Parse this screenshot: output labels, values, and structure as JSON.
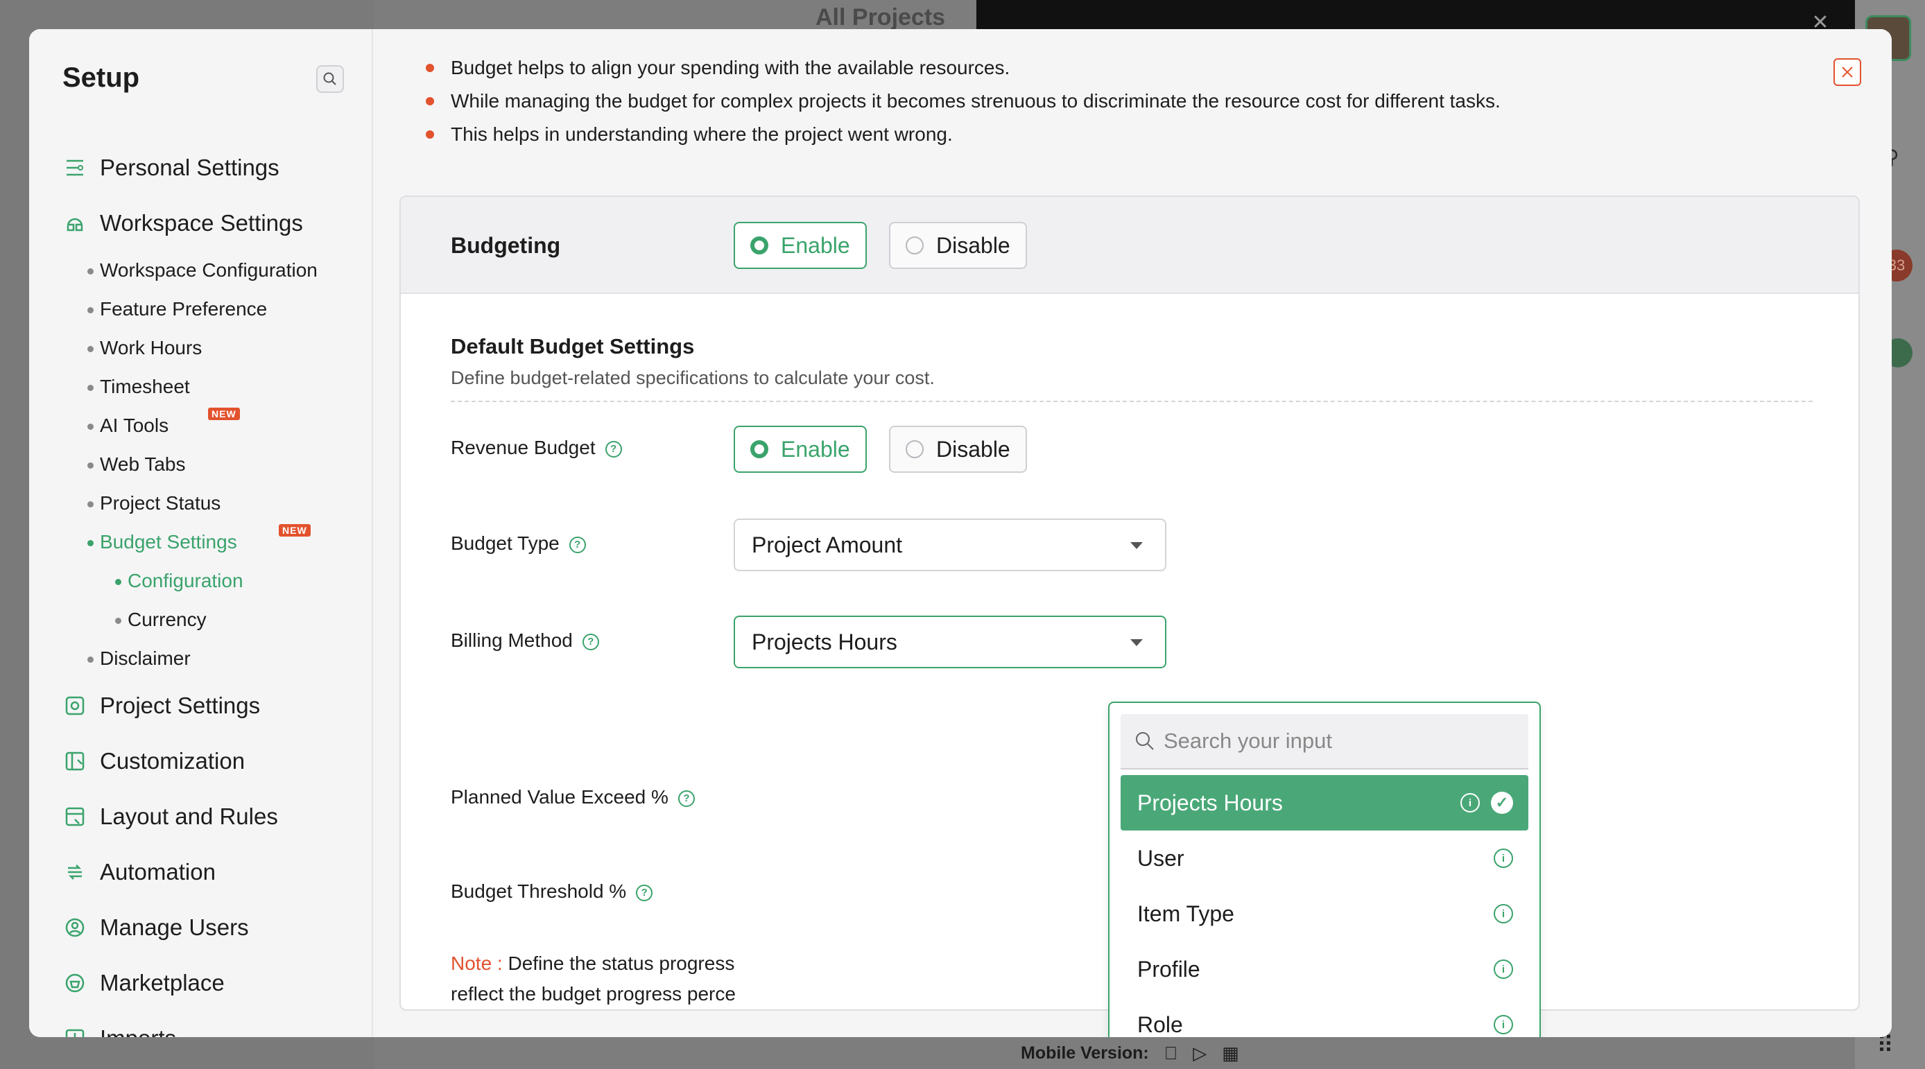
{
  "background": {
    "title": "All Projects",
    "mobile_version_label": "Mobile Version:",
    "notification_count": "33",
    "icons": [
      "apple-icon",
      "play-store-icon",
      "qr-code-icon",
      "grid-icon"
    ]
  },
  "sidebar": {
    "title": "Setup",
    "main_items": [
      {
        "label": "Personal Settings",
        "icon": "personal-settings-icon"
      },
      {
        "label": "Workspace Settings",
        "icon": "workspace-settings-icon"
      },
      {
        "label": "Project Settings",
        "icon": "project-settings-icon"
      },
      {
        "label": "Customization",
        "icon": "customization-icon"
      },
      {
        "label": "Layout and Rules",
        "icon": "layout-rules-icon"
      },
      {
        "label": "Automation",
        "icon": "automation-icon"
      },
      {
        "label": "Manage Users",
        "icon": "manage-users-icon"
      },
      {
        "label": "Marketplace",
        "icon": "marketplace-icon"
      },
      {
        "label": "Imports",
        "icon": "imports-icon"
      }
    ],
    "workspace_sub": [
      {
        "label": "Workspace Configuration"
      },
      {
        "label": "Feature Preference"
      },
      {
        "label": "Work Hours"
      },
      {
        "label": "Timesheet"
      },
      {
        "label": "AI Tools",
        "badge": "NEW"
      },
      {
        "label": "Web Tabs"
      },
      {
        "label": "Project Status"
      },
      {
        "label": "Budget Settings",
        "badge": "NEW",
        "active": true
      },
      {
        "label": "Disclaimer"
      }
    ],
    "budget_sub": [
      {
        "label": "Configuration",
        "active": true
      },
      {
        "label": "Currency"
      }
    ]
  },
  "content": {
    "bullets": [
      "Budget helps to align your spending with the available resources.",
      "While managing the budget for complex projects it becomes strenuous to discriminate the resource cost for different tasks.",
      "This helps in understanding where the project went wrong."
    ],
    "budgeting": {
      "label": "Budgeting",
      "enable": "Enable",
      "disable": "Disable",
      "selected": "Enable"
    },
    "default_settings": {
      "title": "Default Budget Settings",
      "description": "Define budget-related specifications to calculate your cost."
    },
    "revenue_budget": {
      "label": "Revenue Budget",
      "enable": "Enable",
      "disable": "Disable",
      "selected": "Enable"
    },
    "budget_type": {
      "label": "Budget Type",
      "value": "Project Amount"
    },
    "billing_method": {
      "label": "Billing Method",
      "value": "Projects Hours"
    },
    "planned_value": {
      "label": "Planned Value Exceed %"
    },
    "budget_threshold": {
      "label": "Budget Threshold %"
    },
    "note": {
      "prefix": "Note :",
      "text": "Define the status progress",
      "text2": "reflect the budget progress perce"
    }
  },
  "dropdown": {
    "search_placeholder": "Search your input",
    "options": [
      {
        "label": "Projects Hours",
        "selected": true
      },
      {
        "label": "User"
      },
      {
        "label": "Item Type"
      },
      {
        "label": "Profile"
      },
      {
        "label": "Role"
      }
    ]
  },
  "colors": {
    "accent": "#3aa36b",
    "danger": "#e2522d",
    "selected_bg": "#4aa878"
  }
}
